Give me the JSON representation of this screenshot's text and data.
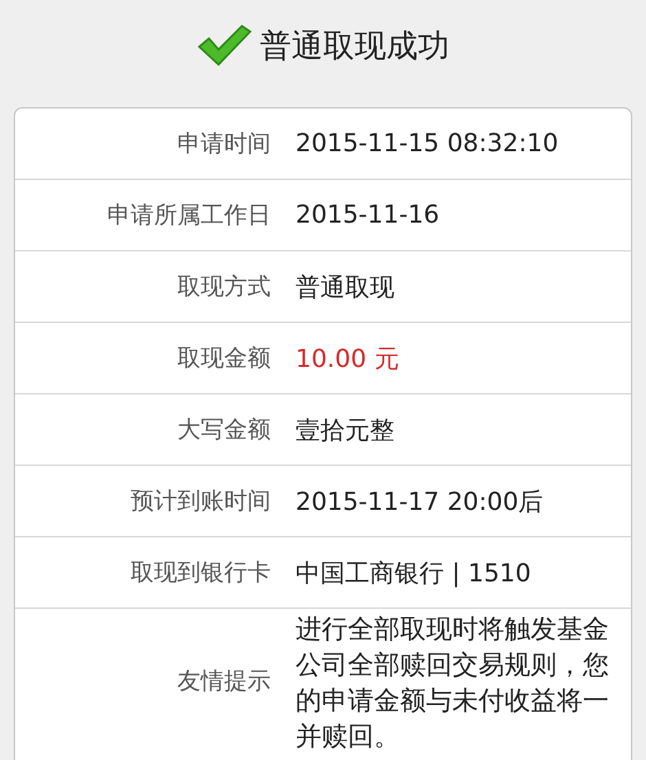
{
  "header": {
    "title": "普通取现成功"
  },
  "rows": [
    {
      "label": "申请时间",
      "value": "2015-11-15 08:32:10",
      "kind": "text"
    },
    {
      "label": "申请所属工作日",
      "value": "2015-11-16",
      "kind": "text"
    },
    {
      "label": "取现方式",
      "value": "普通取现",
      "kind": "text"
    },
    {
      "label": "取现金额",
      "value": "10.00 元",
      "kind": "amount"
    },
    {
      "label": "大写金额",
      "value": "壹拾元整",
      "kind": "text"
    },
    {
      "label": "预计到账时间",
      "value": "2015-11-17 20:00后",
      "kind": "text"
    },
    {
      "label": "取现到银行卡",
      "value": "中国工商银行 | 1510",
      "kind": "text"
    },
    {
      "label": "友情提示",
      "value": "进行全部取现时将触发基金公司全部赎回交易规则，您的申请金额与未付收益将一并赎回。",
      "kind": "note"
    }
  ]
}
